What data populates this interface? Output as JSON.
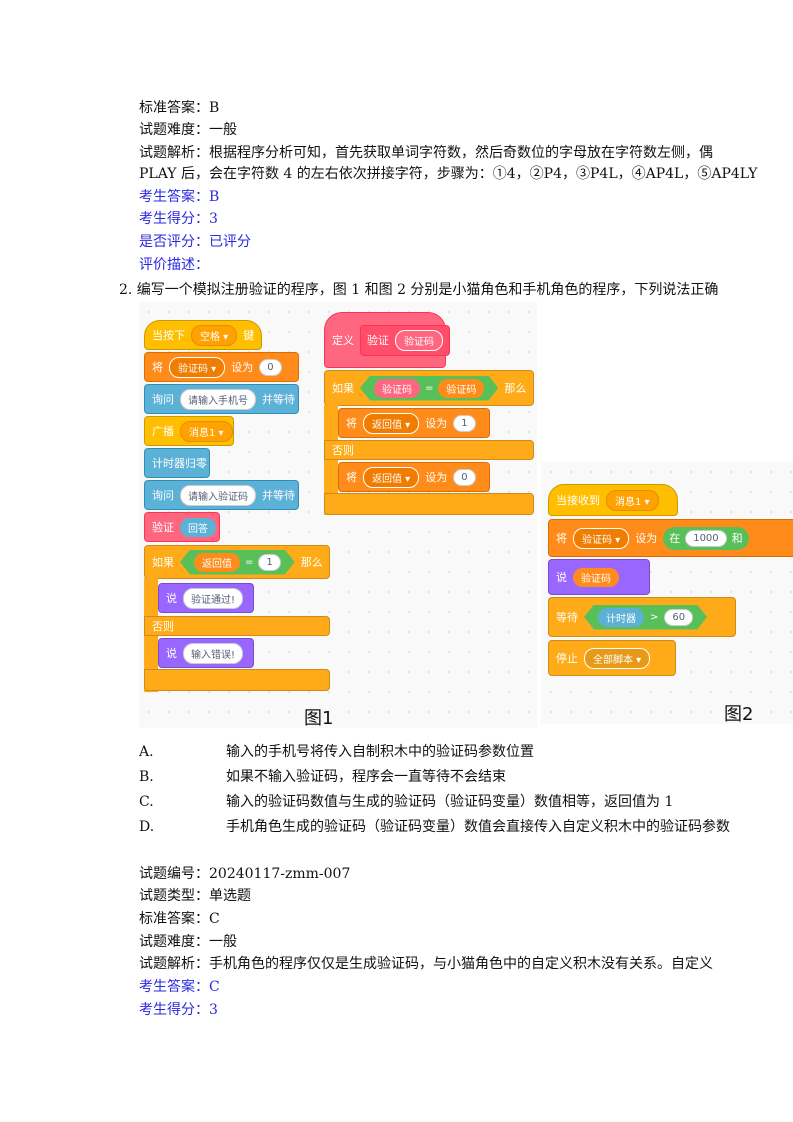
{
  "q1": {
    "std_answer": "标准答案：B",
    "difficulty": "试题难度：一般",
    "analysis_1": "试题解析：根据程序分析可知，首先获取单词字符数，然后奇数位的字母放在字符数左侧，偶",
    "analysis_2": "PLAY 后，会在字符数 4 的左右依次拼接字符，步骤为：①4，②P4，③P4L，④AP4L，⑤AP4LY",
    "student_answer": "考生答案：B",
    "student_score": "考生得分：3",
    "graded": "是否评分：已评分",
    "comment": "评价描述："
  },
  "q2": {
    "stem": "2. 编写一个模拟注册验证的程序，图 1 和图 2 分别是小猫角色和手机角色的程序，下列说法正确",
    "fig1_label": "图1",
    "fig2_label": "图2",
    "options": [
      {
        "letter": "A.",
        "text": "输入的手机号将传入自制积木中的验证码参数位置"
      },
      {
        "letter": "B.",
        "text": "如果不输入验证码，程序会一直等待不会结束"
      },
      {
        "letter": "C.",
        "text": "输入的验证码数值与生成的验证码（验证码变量）数值相等，返回值为 1"
      },
      {
        "letter": "D.",
        "text": "手机角色生成的验证码（验证码变量）数值会直接传入自定义积木中的验证码参数"
      }
    ],
    "id": "试题编号：20240117-zmm-007",
    "type": "试题类型：单选题",
    "std_answer": "标准答案：C",
    "difficulty": "试题难度：一般",
    "analysis": "试题解析：手机角色的程序仅仅是生成验证码，与小猫角色中的自定义积木没有关系。自定义",
    "student_answer": "考生答案：C",
    "student_score": "考生得分：3"
  },
  "fig1": {
    "when_key": "当按下",
    "key": "空格 ▾",
    "key_suffix": "键",
    "set": "将",
    "var": "验证码 ▾",
    "set_to": "设为",
    "zero": "0",
    "ask1": "询问",
    "ask1_q": "请输入手机号",
    "wait": "并等待",
    "broadcast": "广播",
    "msg": "消息1 ▾",
    "timer_reset": "计时器归零",
    "ask2": "询问",
    "ask2_q": "请输入验证码",
    "wait2": "并等待",
    "verify": "验证",
    "answer": "回答",
    "if": "如果",
    "retval": "返回值",
    "eq": "=",
    "one": "1",
    "then": "那么",
    "say1": "说",
    "say1_text": "验证通过!",
    "else": "否则",
    "say2": "说",
    "say2_text": "输入错误!",
    "def": "定义",
    "def_name": "验证",
    "def_param": "验证码",
    "if2": "如果",
    "param": "验证码",
    "eq2": "=",
    "var2": "验证码",
    "then2": "那么",
    "set2": "将",
    "retvar": "返回值 ▾",
    "set2_to": "设为",
    "set2_val": "1",
    "else2": "否则",
    "set3": "将",
    "retvar3": "返回值 ▾",
    "set3_to": "设为",
    "set3_val": "0"
  },
  "fig2": {
    "when_recv": "当接收到",
    "msg": "消息1 ▾",
    "set": "将",
    "var": "验证码 ▾",
    "set_to": "设为",
    "in": "在",
    "from": "1000",
    "and": "和",
    "say": "说",
    "say_var": "验证码",
    "wait": "等待",
    "timer": "计时器",
    "gt": ">",
    "sixty": "60",
    "stop": "停止",
    "stop_opt": "全部脚本 ▾"
  }
}
